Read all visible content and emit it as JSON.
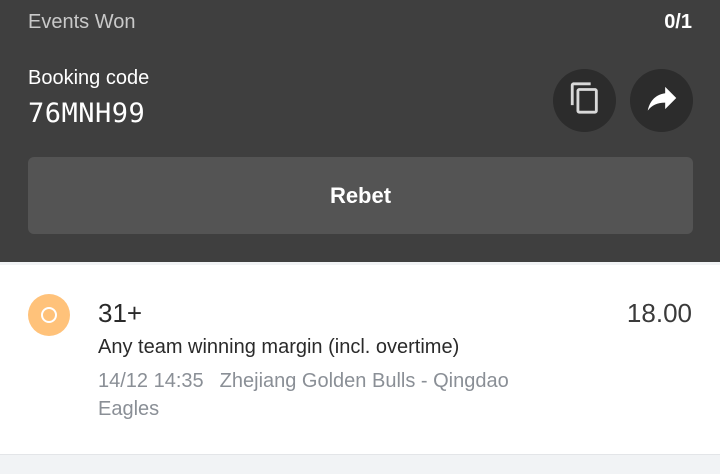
{
  "summary": {
    "events_won_label": "Events Won",
    "events_won_value": "0/1"
  },
  "booking": {
    "label": "Booking code",
    "code": "76MNH99"
  },
  "actions": {
    "copy_icon": "copy-icon",
    "share_icon": "share-icon",
    "rebet_label": "Rebet"
  },
  "bet": {
    "status_color": "#ffc27a",
    "selection": "31+",
    "odds": "18.00",
    "market": "Any team winning margin (incl. overtime)",
    "datetime": "14/12 14:35",
    "match": "Zhejiang Golden Bulls - Qingdao Eagles"
  }
}
